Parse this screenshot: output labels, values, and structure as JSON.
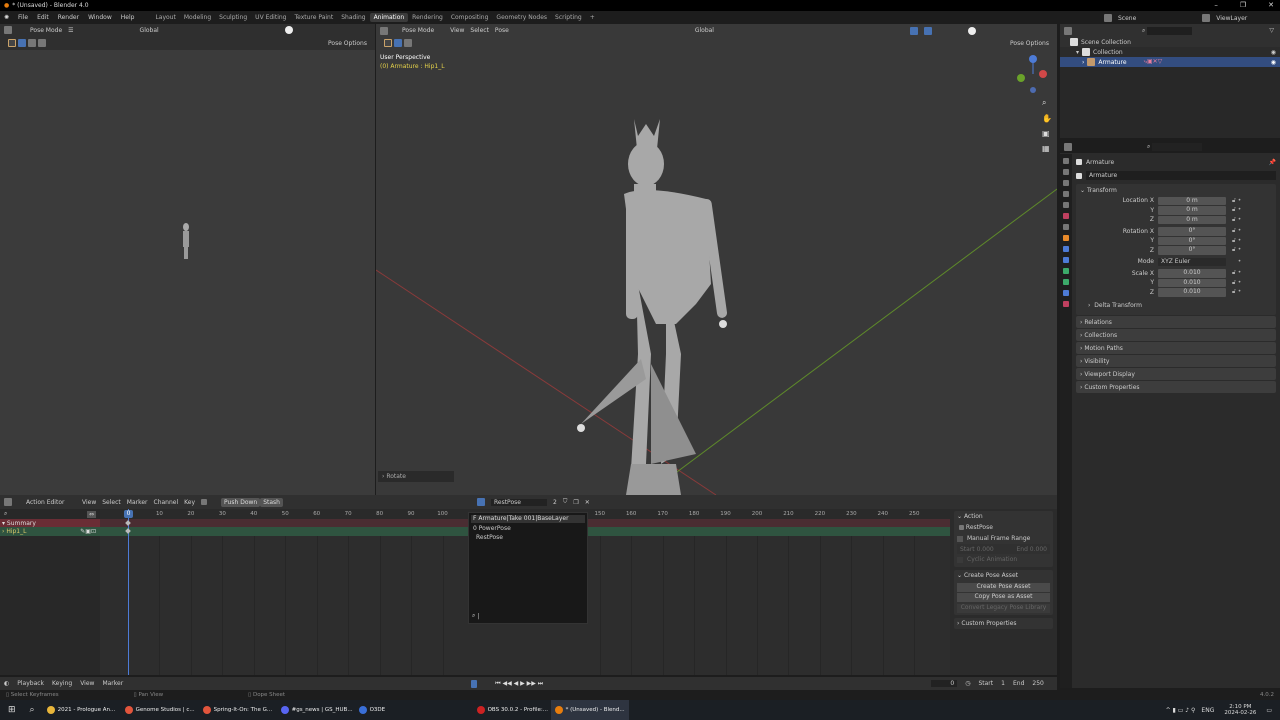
{
  "window": {
    "title": "* (Unsaved) - Blender 4.0",
    "controls": [
      "–",
      "❐",
      "✕"
    ]
  },
  "menu": {
    "items": [
      "File",
      "Edit",
      "Render",
      "Window",
      "Help"
    ],
    "workspaces": [
      "Layout",
      "Modeling",
      "Sculpting",
      "UV Editing",
      "Texture Paint",
      "Shading",
      "Animation",
      "Rendering",
      "Compositing",
      "Geometry Nodes",
      "Scripting",
      "+"
    ],
    "active_workspace": "Animation"
  },
  "left_view": {
    "mode": "Pose Mode",
    "orientation": "Global",
    "pose_options": "Pose Options"
  },
  "main_view": {
    "mode": "Pose Mode",
    "menus": [
      "View",
      "Select",
      "Pose"
    ],
    "orientation": "Global",
    "pose_options": "Pose Options",
    "overlay_title": "User Perspective",
    "overlay_sub": "(0) Armature : Hip1_L",
    "last_op": "Rotate"
  },
  "outliner": {
    "scene": "Scene",
    "view_layer": "ViewLayer",
    "items": [
      "Scene Collection",
      "Collection",
      "Armature"
    ]
  },
  "properties": {
    "object": "Armature",
    "data_name": "Armature",
    "section": "Transform",
    "rows": [
      {
        "label": "Location X",
        "value": "0 m"
      },
      {
        "label": "Y",
        "value": "0 m"
      },
      {
        "label": "Z",
        "value": "0 m"
      },
      {
        "label": "Rotation X",
        "value": "0°"
      },
      {
        "label": "Y",
        "value": "0°"
      },
      {
        "label": "Z",
        "value": "0°"
      },
      {
        "label": "Mode",
        "value": "XYZ Euler"
      },
      {
        "label": "Scale X",
        "value": "0.010"
      },
      {
        "label": "Y",
        "value": "0.010"
      },
      {
        "label": "Z",
        "value": "0.010"
      }
    ],
    "delta": "Delta Transform",
    "panels": [
      "Relations",
      "Collections",
      "Motion Paths",
      "Visibility",
      "Viewport Display",
      "Custom Properties"
    ]
  },
  "action_editor": {
    "mode": "Action Editor",
    "menus": [
      "View",
      "Select",
      "Marker",
      "Channel",
      "Key"
    ],
    "push_down": "Push Down",
    "stash": "Stash",
    "action": "RestPose",
    "users": "2",
    "ticks": [
      0,
      10,
      20,
      30,
      40,
      50,
      60,
      70,
      80,
      90,
      100,
      150,
      160,
      170,
      180,
      190,
      200,
      210,
      220,
      230,
      240,
      250
    ],
    "current_frame": "0",
    "channels": [
      "Summary",
      "Hip1_L"
    ],
    "dropdown": {
      "items": [
        "F Armature|Take 001|BaseLayer",
        "0 PowerPose",
        "RestPose"
      ]
    },
    "sidebar": {
      "action_header": "Action",
      "action_name": "RestPose",
      "manual_range": "Manual Frame Range",
      "start": "Start  0.000",
      "end": "End  0.000",
      "cyclic": "Cyclic Animation",
      "create_header": "Create Pose Asset",
      "create_btn": "Create Pose Asset",
      "copy_btn": "Copy Pose as Asset",
      "convert_btn": "Convert Legacy Pose Library",
      "custom": "Custom Properties"
    }
  },
  "timeline": {
    "menus": [
      "Playback",
      "Keying",
      "View",
      "Marker"
    ],
    "frame": "0",
    "start_label": "Start",
    "start": "1",
    "end_label": "End",
    "end": "250"
  },
  "status": {
    "items": [
      "Select Keyframes",
      "Pan View",
      "Dope Sheet"
    ],
    "version": "4.0.2"
  },
  "taskbar": {
    "apps": [
      {
        "label": "2021 - Prologue An...",
        "color": "#e8b53a"
      },
      {
        "label": "Genome Studios | c...",
        "color": "#e2553c"
      },
      {
        "label": "Spring-It-On: The G...",
        "color": "#e2553c"
      },
      {
        "label": "#gs_news | GS_HUB...",
        "color": "#5865f2"
      },
      {
        "label": "O3DE",
        "color": "#3a6fd8"
      },
      {
        "label": "OBS 30.0.2 - Profile:...",
        "color": "#c22"
      },
      {
        "label": "* (Unsaved) - Blend...",
        "color": "#e87d0d"
      }
    ],
    "lang": "ENG",
    "time": "2:10 PM",
    "date": "2024-02-26"
  }
}
